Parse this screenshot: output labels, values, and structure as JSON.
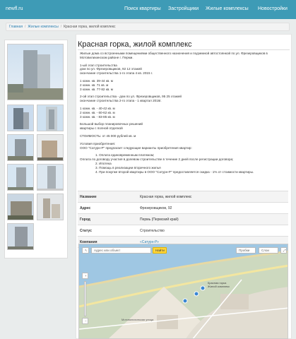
{
  "header": {
    "logo": "newfl.ru",
    "nav": [
      "Поиск квартиры",
      "Застройщики",
      "Жилые комплексы",
      "Новостройки"
    ]
  },
  "breadcrumbs": {
    "home": "Главная",
    "section": "Жилые комплексы",
    "current": "Красная горка, жилой комплекс"
  },
  "page_title": "Красная горка, жилой комплекс",
  "description": {
    "intro": "Жилые дома со встроенными помещениями общественного назначения и подземной автостоянкой по ул. Фрезеровщиков в Мотовилихинском районе г. Перми.",
    "q1_head": "1-ый этап строительства",
    "q1_l1": "дом по ул. Фрезеровщиков, 92 12 этажей",
    "q1_l2": "окончание строительства 1-го этапа 4 кв. 2015 г.",
    "q1_a1": "1 комн. кв. 39-44 кв. м",
    "q1_a2": "2 комн. кв. 71 кв. м",
    "q1_a3": "3 комн. кв. 77-82 кв. м",
    "q2_head": "2-ой этап строительства - дом по ул. Фрезеровщиков, 95 25 этажей",
    "q2_l1": "окончание строительства 2-го этапа - 1 квартал 2016г.",
    "q2_a1": "1 комн. кв. - 40-42 кв. м",
    "q2_a2": "2 комн. кв. - 60-62 кв. м",
    "q2_a3": "3 комн. кв. - 83-85 кв. м",
    "big1": "Большой выбор планировочных решений",
    "big2": "квартиры с полной отделкой",
    "price": "СТОИМОСТЬ: от 45 000 рублей кв. м",
    "cond_head": "Условия приобретения:",
    "cond_l1": "ООО \"Сатурн-Р\" предлагает следующие варианты приобретения квартир:",
    "cond_o1": "1. Оплата единовременным платежом;",
    "cond_l2": "Оплата по договору участия в долевом строительстве в течение 2 дней после регистрации договора;",
    "cond_o2": "2. Ипотека",
    "cond_o3": "3. Помощь в реализации вторичного жилья",
    "cond_o4": "4. При покупке второй квартиры в ООО \"Сатурн-Р\" предоставляется скидка - 1% от стоимости квартиры."
  },
  "table": [
    {
      "k": "Название",
      "v": "Красная горка, жилой комплекс"
    },
    {
      "k": "Адрес",
      "v": "Фрезеровщиков, 92"
    },
    {
      "k": "Город",
      "v": "Пермь (Пермский край)"
    },
    {
      "k": "Статус",
      "v": "Строительство"
    },
    {
      "k": "Компания",
      "v": "«Сатурн-Р»"
    }
  ],
  "map": {
    "search_placeholder": "Адрес или объект",
    "find_label": "Найти",
    "traffic_label": "Пробки",
    "layers_label": "Слои",
    "plus": "+",
    "minus": "−",
    "label1": "Красная горка",
    "label2": "Жилой комплекс",
    "label3": "Мотовилихинская улица"
  }
}
